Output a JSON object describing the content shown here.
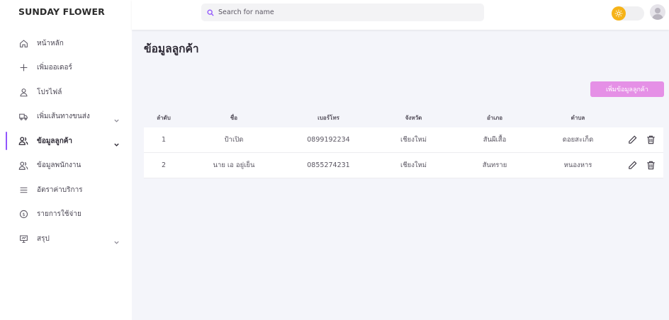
{
  "brand": "SUNDAY FLOWER",
  "search": {
    "placeholder": "Search for name",
    "value": ""
  },
  "sidebar": {
    "items": [
      {
        "label": "หน้าหลัก",
        "icon": "home-icon"
      },
      {
        "label": "เพิ่มออเดอร์",
        "icon": "plus-icon"
      },
      {
        "label": "โปรไฟล์",
        "icon": "user-icon"
      },
      {
        "label": "เพิ่มเส้นทางขนส่ง",
        "icon": "truck-icon"
      },
      {
        "label": "ข้อมูลลูกค้า",
        "icon": "users-icon",
        "active": true
      },
      {
        "label": "ข้อมูลพนักงาน",
        "icon": "users-icon"
      },
      {
        "label": "อัตราค่าบริการ",
        "icon": "list-icon"
      },
      {
        "label": "รายการใช้จ่าย",
        "icon": "dollar-icon"
      },
      {
        "label": "สรุป",
        "icon": "presentation-icon"
      }
    ]
  },
  "page": {
    "title": "ข้อมูลลูกค้า",
    "add_button": "เพิ่มข้อมูลลูกค้า"
  },
  "table": {
    "headers": [
      "ลำดับ",
      "ชื่อ",
      "เบอร์โทร",
      "จังหวัด",
      "อำเภอ",
      "ตำบล"
    ],
    "rows": [
      [
        "1",
        "ป้าเปิด",
        "0899192234",
        "เชียงใหม่",
        "สันผีเสื้อ",
        "ดอยสะเก็ด"
      ],
      [
        "2",
        "นาย เอ อยู่เย็น",
        "0855274231",
        "เชียงใหม่",
        "สันทราย",
        "หนองหาร"
      ]
    ]
  },
  "colors": {
    "accent": "#9155fd",
    "button": "#e590e6",
    "sun": "#f6b318"
  }
}
